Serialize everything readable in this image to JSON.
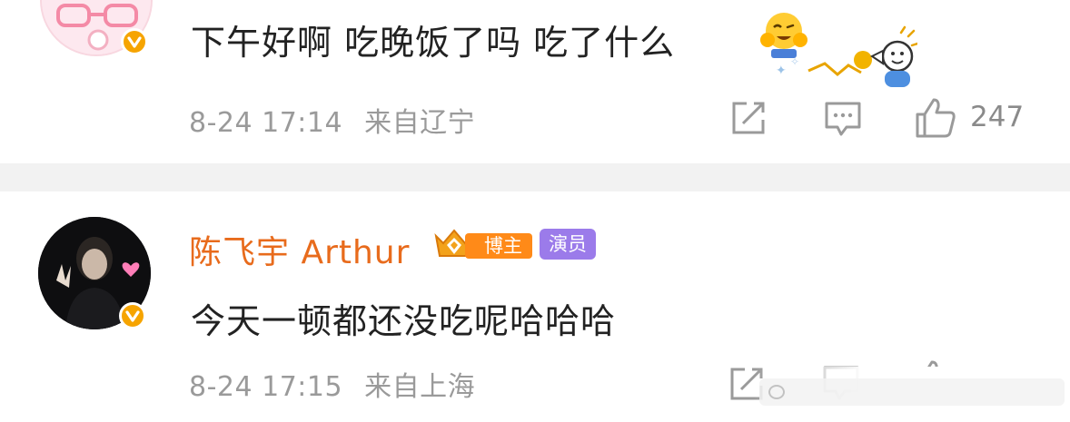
{
  "comments": [
    {
      "text": "下午好啊 吃晚饭了吗 吃了什么",
      "time": "8-24 17:14",
      "location": "来自辽宁",
      "likes": "247",
      "verified": true,
      "emoji": "hug-emoji",
      "sticker": "cheering-stick-figure-sticker"
    },
    {
      "username": "陈飞宇 Arthur",
      "badges": [
        "博主",
        "演员"
      ],
      "text": "今天一顿都还没吃呢哈哈哈",
      "time": "8-24 17:15",
      "location": "来自上海",
      "likes": "",
      "verified": true
    }
  ],
  "icons": {
    "share": "share-icon",
    "comment": "comment-icon",
    "like": "thumbs-up-icon",
    "verified": "verified-v-icon"
  },
  "colors": {
    "username": "#e86b1c",
    "verified_badge": "#f6a400",
    "blogger_badge": "#ff8a18",
    "actor_badge": "#9b7bea",
    "meta_text": "#9a9a9a",
    "separator": "#f2f2f2"
  }
}
